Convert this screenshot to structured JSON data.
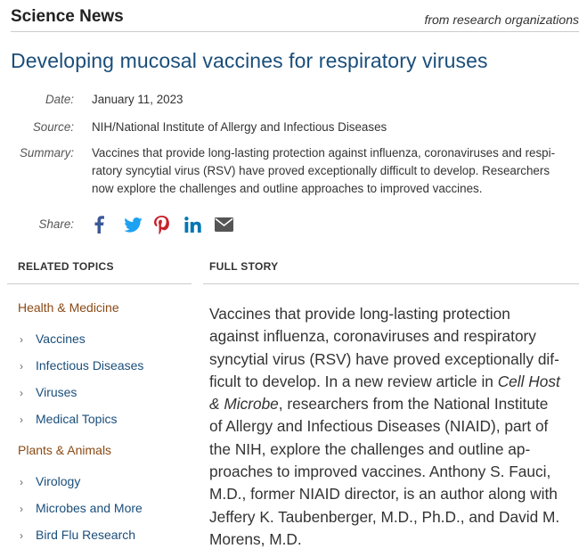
{
  "header": {
    "brand": "Science News",
    "tagline": "from research organizations"
  },
  "article": {
    "title": "Developing mucosal vaccines for respiratory viruses",
    "date_label": "Date:",
    "date": "January 11, 2023",
    "source_label": "Source:",
    "source": "NIH/National Institute of Allergy and Infectious Diseases",
    "summary_label": "Summary:",
    "summary_lines": [
      "Vaccines that provide long-lasting protection against influenza, coronaviruses and respi-",
      "ratory syncytial virus (RSV) have proved exceptionally difficult to develop. Researchers",
      "now explore the challenges and outline approaches to improved vaccines."
    ]
  },
  "share": {
    "label": "Share:",
    "icons": [
      "facebook-icon",
      "twitter-icon",
      "pinterest-icon",
      "linkedin-icon",
      "email-icon"
    ],
    "colors": {
      "facebook": "#3b5998",
      "twitter": "#1da1f2",
      "pinterest": "#c8232c",
      "linkedin": "#0077b5",
      "email": "#555555"
    }
  },
  "related": {
    "heading": "RELATED TOPICS",
    "categories": [
      {
        "name": "Health & Medicine",
        "topics": [
          "Vaccines",
          "Infectious Diseases",
          "Viruses",
          "Medical Topics"
        ]
      },
      {
        "name": "Plants & Animals",
        "topics": [
          "Virology",
          "Microbes and More",
          "Bird Flu Research"
        ]
      }
    ],
    "chevron": "›"
  },
  "story": {
    "heading": "FULL STORY",
    "lines": [
      {
        "text": "Vaccines that provide long-lasting protection"
      },
      {
        "text": "against influenza, coronaviruses and respiratory"
      },
      {
        "text": "syncytial virus (RSV) have proved exceptionally dif-"
      },
      {
        "pre": "ficult to develop. In a new review article in ",
        "italic": "Cell Host"
      },
      {
        "italic": "& Microbe",
        "post": ", researchers from the National Institute"
      },
      {
        "text": "of Allergy and Infectious Diseases (NIAID), part of"
      },
      {
        "text": "the NIH, explore the challenges and outline ap-"
      },
      {
        "text": "proaches to improved vaccines. Anthony S. Fauci,"
      },
      {
        "text": "M.D., former NIAID director, is an author along with"
      },
      {
        "text": "Jeffery K. Taubenberger, M.D., Ph.D., and David M."
      },
      {
        "text": "Morens, M.D."
      }
    ]
  },
  "colors": {
    "title": "#1a4e7a",
    "link": "#1a4e7a",
    "category": "#8a4a16"
  }
}
